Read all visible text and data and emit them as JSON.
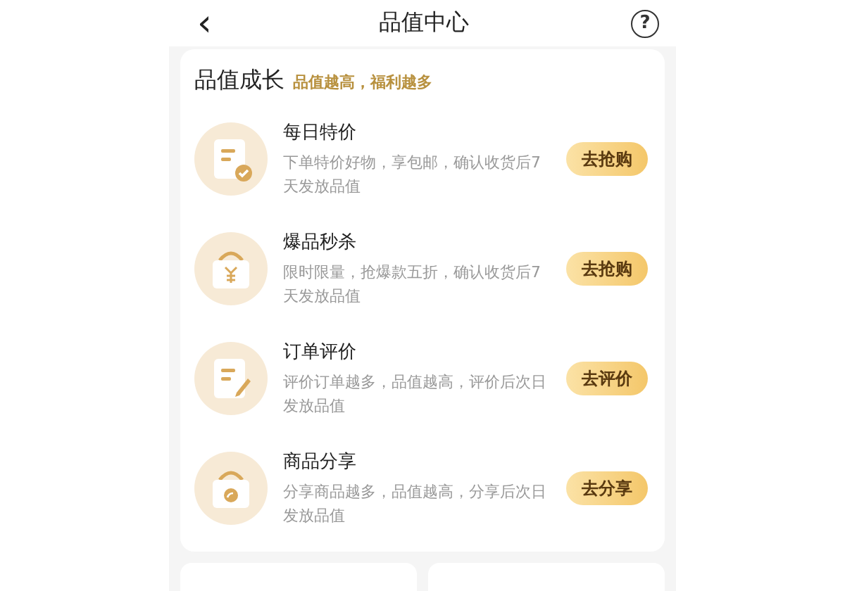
{
  "header": {
    "back": "‹",
    "title": "品值中心",
    "help": "?"
  },
  "section": {
    "title": "品值成长",
    "subtitle": "品值越高，福利越多"
  },
  "tasks": [
    {
      "kind": "doc-check",
      "title": "每日特价",
      "desc": "下单特价好物，享包邮，确认收货后7天发放品值",
      "button": "去抢购"
    },
    {
      "kind": "bag-yen",
      "title": "爆品秒杀",
      "desc": "限时限量，抢爆款五折，确认收货后7天发放品值",
      "button": "去抢购"
    },
    {
      "kind": "doc-pen",
      "title": "订单评价",
      "desc": "评价订单越多，品值越高，评价后次日发放品值",
      "button": "去评价"
    },
    {
      "kind": "bag-share",
      "title": "商品分享",
      "desc": "分享商品越多，品值越高，分享后次日发放品值",
      "button": "去分享"
    }
  ]
}
